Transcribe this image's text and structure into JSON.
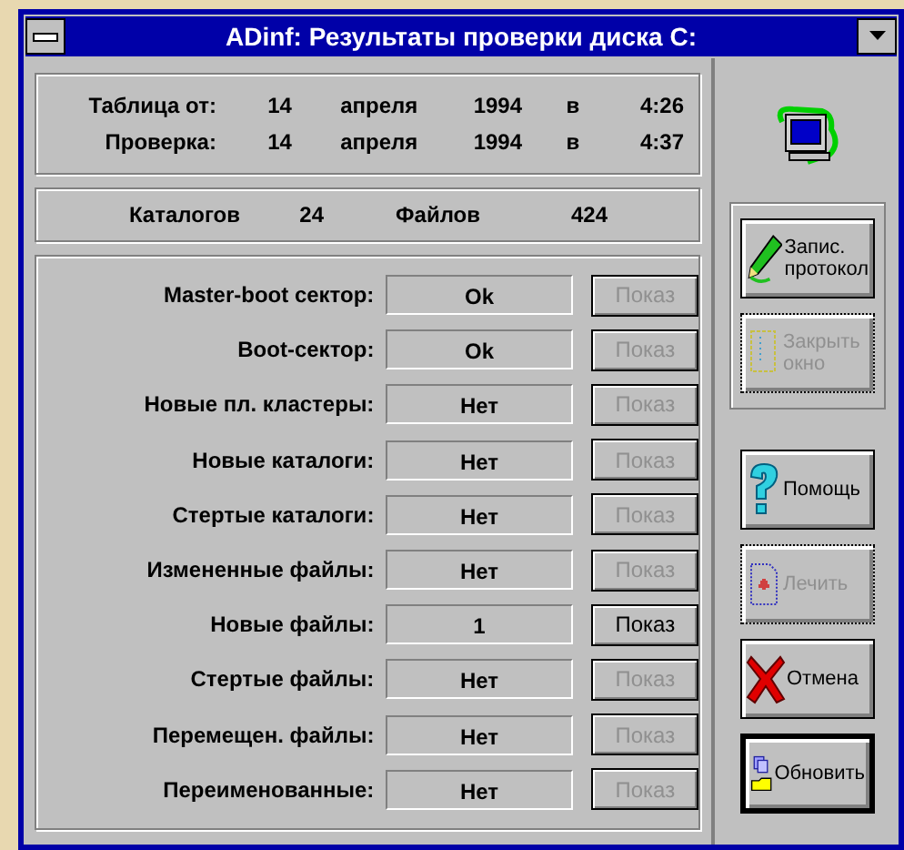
{
  "window": {
    "title": "ADinf: Результаты проверки диска C:"
  },
  "dates": [
    {
      "label": "Таблица от:",
      "day": "14",
      "month": "апреля",
      "year": "1994",
      "at": "в",
      "time": "4:26"
    },
    {
      "label": "Проверка:",
      "day": "14",
      "month": "апреля",
      "year": "1994",
      "at": "в",
      "time": "4:37"
    }
  ],
  "counts": [
    {
      "label": "Каталогов",
      "value": "24"
    },
    {
      "label": "Файлов",
      "value": "424"
    }
  ],
  "checks": [
    {
      "label": "Master-boot  сектор:",
      "value": "Ok",
      "button": "Показ",
      "disabled": true
    },
    {
      "label": "Boot-сектор:",
      "value": "Ok",
      "button": "Показ",
      "disabled": true
    },
    {
      "label": "Новые пл. кластеры:",
      "value": "Нет",
      "button": "Показ",
      "disabled": true
    },
    {
      "label": "Новые каталоги:",
      "value": "Нет",
      "button": "Показ",
      "disabled": true
    },
    {
      "label": "Стертые каталоги:",
      "value": "Нет",
      "button": "Показ",
      "disabled": true
    },
    {
      "label": "Измененные файлы:",
      "value": "Нет",
      "button": "Показ",
      "disabled": true
    },
    {
      "label": "Новые файлы:",
      "value": "1",
      "button": "Показ",
      "disabled": false
    },
    {
      "label": "Стертые файлы:",
      "value": "Нет",
      "button": "Показ",
      "disabled": true
    },
    {
      "label": "Перемещен. файлы:",
      "value": "Нет",
      "button": "Показ",
      "disabled": true
    },
    {
      "label": "Переименованные:",
      "value": "Нет",
      "button": "Показ",
      "disabled": true
    }
  ],
  "group_buttons": [
    {
      "kind": "pencil",
      "label": "Запис. протокол",
      "disabled": false,
      "default": false
    },
    {
      "kind": "page",
      "label": "Закрыть окно",
      "disabled": true,
      "default": false
    }
  ],
  "buttons": [
    {
      "kind": "help",
      "label": "Помощь",
      "disabled": false,
      "default": false
    },
    {
      "kind": "cure",
      "label": "Лечить",
      "disabled": true,
      "default": false
    },
    {
      "kind": "cancel",
      "label": "Отмена",
      "disabled": false,
      "default": false
    },
    {
      "kind": "refresh",
      "label": "Обновить",
      "disabled": false,
      "default": true
    }
  ]
}
